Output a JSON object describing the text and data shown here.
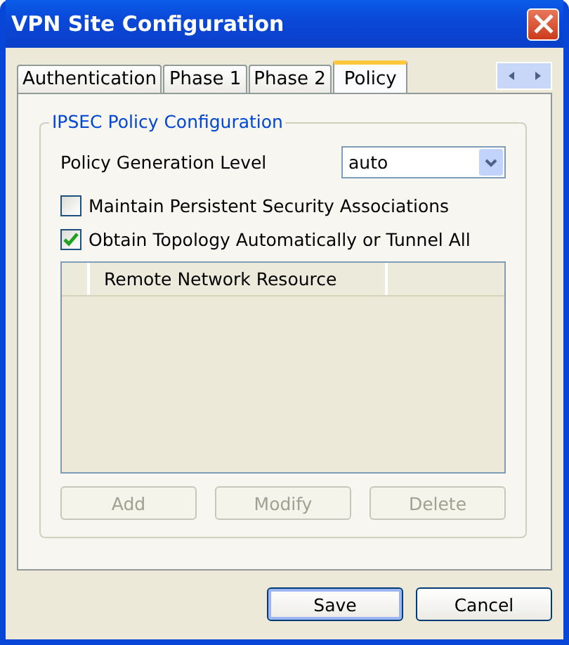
{
  "window": {
    "title": "VPN Site Configuration"
  },
  "tabs": [
    {
      "label": "Authentication",
      "selected": false
    },
    {
      "label": "Phase 1",
      "selected": false
    },
    {
      "label": "Phase 2",
      "selected": false
    },
    {
      "label": "Policy",
      "selected": true
    }
  ],
  "group": {
    "title": "IPSEC Policy Configuration",
    "policy_level": {
      "label": "Policy Generation Level",
      "value": "auto"
    },
    "checkboxes": [
      {
        "label": "Maintain Persistent Security Associations",
        "checked": false
      },
      {
        "label": "Obtain Topology Automatically or Tunnel All",
        "checked": true
      }
    ],
    "list": {
      "columns": [
        "Remote Network Resource"
      ]
    },
    "buttons": [
      {
        "label": "Add",
        "disabled": true
      },
      {
        "label": "Modify",
        "disabled": true
      },
      {
        "label": "Delete",
        "disabled": true
      }
    ]
  },
  "dialog_buttons": [
    {
      "label": "Save",
      "default": true
    },
    {
      "label": "Cancel",
      "default": false
    }
  ]
}
